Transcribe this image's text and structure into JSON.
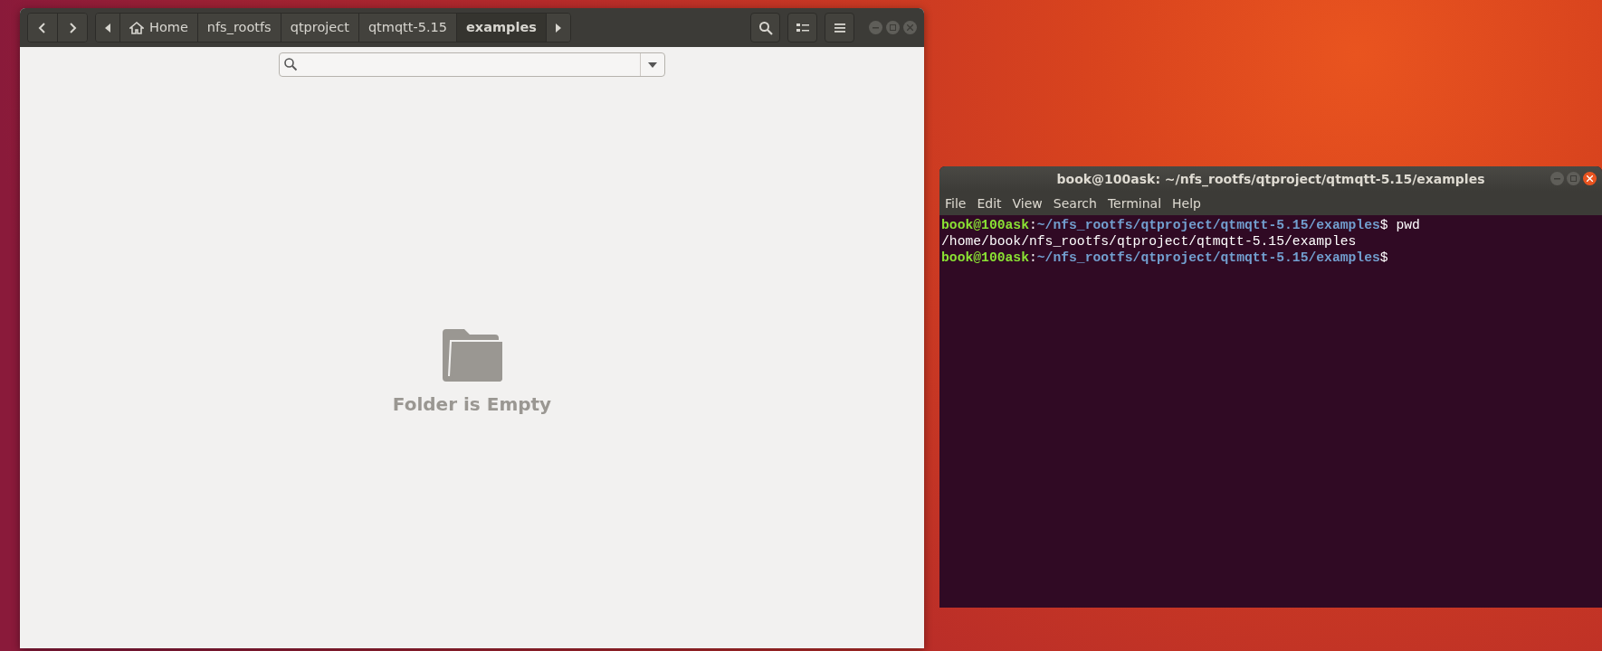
{
  "file_manager": {
    "breadcrumbs": [
      {
        "label": "Home",
        "kind": "home",
        "selected": false
      },
      {
        "label": "nfs_rootfs",
        "kind": "folder",
        "selected": false
      },
      {
        "label": "qtproject",
        "kind": "folder",
        "selected": false
      },
      {
        "label": "qtmqtt-5.15",
        "kind": "folder",
        "selected": false
      },
      {
        "label": "examples",
        "kind": "folder",
        "selected": true
      }
    ],
    "empty_message": "Folder is Empty"
  },
  "terminal": {
    "title": "book@100ask: ~/nfs_rootfs/qtproject/qtmqtt-5.15/examples",
    "menu": [
      "File",
      "Edit",
      "View",
      "Search",
      "Terminal",
      "Help"
    ],
    "lines": [
      {
        "kind": "prompt",
        "user": "book@100ask",
        "separator": ":",
        "path": "~/nfs_rootfs/qtproject/qtmqtt-5.15/examples",
        "sign": "$",
        "command": "pwd"
      },
      {
        "kind": "output",
        "text": "/home/book/nfs_rootfs/qtproject/qtmqtt-5.15/examples"
      },
      {
        "kind": "prompt",
        "user": "book@100ask",
        "separator": ":",
        "path": "~/nfs_rootfs/qtproject/qtmqtt-5.15/examples",
        "sign": "$"
      }
    ]
  }
}
